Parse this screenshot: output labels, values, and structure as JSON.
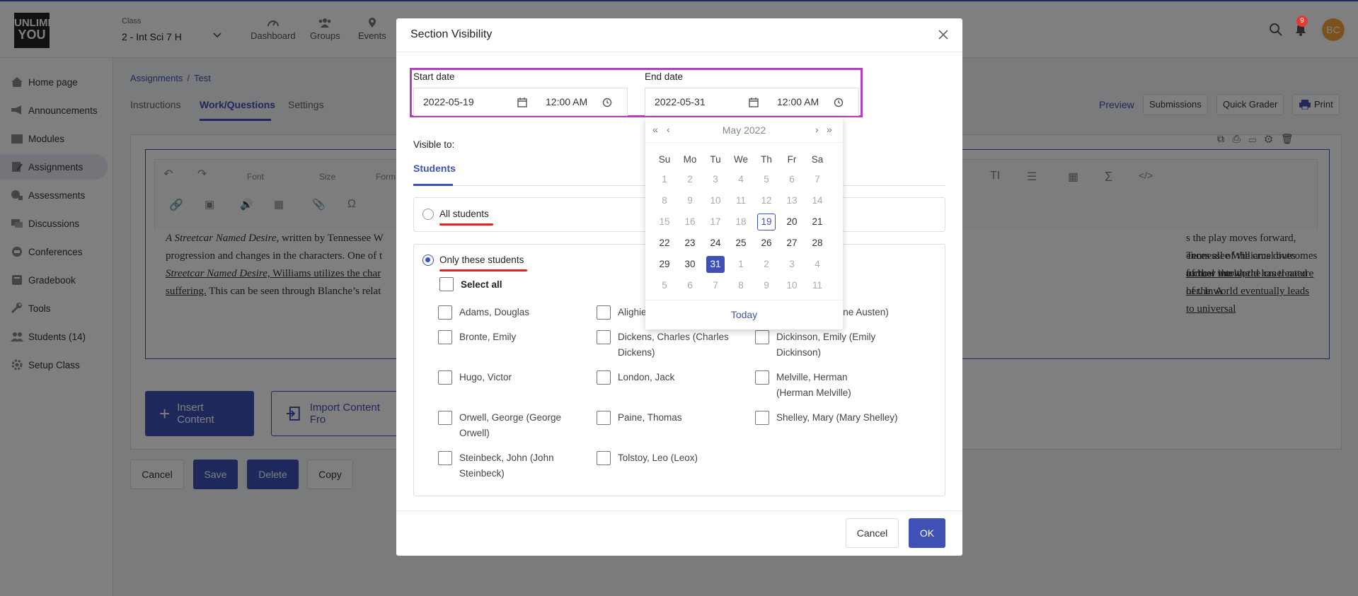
{
  "header": {
    "logo_text": "UNLIMITED YOU",
    "class_label": "Class",
    "class_value": "2 - Int Sci 7 H",
    "nav": [
      {
        "label": "Dashboard",
        "icon": "gauge-icon"
      },
      {
        "label": "Groups",
        "icon": "groups-icon"
      },
      {
        "label": "Events",
        "icon": "location-pin-icon"
      }
    ],
    "notification_count": "9",
    "avatar_initials": "BC"
  },
  "sidebar": {
    "items": [
      {
        "label": "Home page",
        "icon": "home-icon"
      },
      {
        "label": "Announcements",
        "icon": "megaphone-icon"
      },
      {
        "label": "Modules",
        "icon": "modules-icon"
      },
      {
        "label": "Assignments",
        "icon": "assignment-icon",
        "active": true
      },
      {
        "label": "Assessments",
        "icon": "assessment-icon"
      },
      {
        "label": "Discussions",
        "icon": "discussion-icon"
      },
      {
        "label": "Conferences",
        "icon": "conference-icon"
      },
      {
        "label": "Gradebook",
        "icon": "gradebook-icon"
      },
      {
        "label": "Tools",
        "icon": "wrench-icon"
      },
      {
        "label": "Students (14)",
        "icon": "students-icon"
      },
      {
        "label": "Setup Class",
        "icon": "gear-icon"
      }
    ]
  },
  "breadcrumb": {
    "root": "Assignments",
    "sep": "/",
    "current": "Test"
  },
  "page_tabs": [
    "Instructions",
    "Work/Questions",
    "Settings"
  ],
  "right_actions": {
    "preview": "Preview",
    "submissions": "Submissions",
    "quick_grader": "Quick Grader",
    "print": "Print"
  },
  "editor": {
    "font_label": "Font",
    "size_label": "Size",
    "format_label": "Form",
    "text_title": "A Streetcar Named Desire,",
    "text_line1": " written by Tennessee W",
    "text_line2": "progression and changes in the characters. One of t",
    "text_line3a": "Streetcar Named Desire,",
    "text_line3b": " Williams utilizes the char",
    "text_line4a": "suffering.",
    "text_line4b": " This can be seen through Blanche’s relat",
    "text_right1": "s the play moves forward, Tennessee Williams dives further into the",
    "text_right2a": "ences all of the cruel outcomes of how the world has treated her. ",
    "text_right2b": "In A",
    "text_right3": "a cruel world; the cruel nature of the world eventually leads to universal"
  },
  "content_buttons": {
    "insert": "Insert Content",
    "import": "Import Content Fro"
  },
  "footer_buttons": {
    "cancel": "Cancel",
    "save": "Save",
    "delete": "Delete",
    "copy": "Copy"
  },
  "modal": {
    "title": "Section Visibility",
    "start_label": "Start date",
    "start_date": "2022-05-19",
    "start_time": "12:00 AM",
    "end_label": "End date",
    "end_date": "2022-05-31",
    "end_time": "12:00 AM",
    "visible_to": "Visible to:",
    "tab_students": "Students",
    "all_students": "All students",
    "only_these": "Only these students",
    "select_all": "Select all",
    "students": [
      "Adams, Douglas",
      "Alighie",
      "Jane Austen)",
      "Bronte, Emily",
      "Dickens, Charles (Charles Dickens)",
      "Dickinson, Emily (Emily Dickinson)",
      "Hugo, Victor",
      "London, Jack",
      "Melville, Herman (Herman Melville)",
      "Orwell, George (George Orwell)",
      "Paine, Thomas",
      "Shelley, Mary (Mary Shelley)",
      "Steinbeck, John (John Steinbeck)",
      "Tolstoy, Leo (Leox)"
    ],
    "cancel": "Cancel",
    "ok": "OK"
  },
  "calendar": {
    "month": "May 2022",
    "nav_first": "«",
    "nav_prev": "‹",
    "nav_next": "›",
    "nav_last": "»",
    "weekdays": [
      "Su",
      "Mo",
      "Tu",
      "We",
      "Th",
      "Fr",
      "Sa"
    ],
    "weeks": [
      [
        "1",
        "2",
        "3",
        "4",
        "5",
        "6",
        "7"
      ],
      [
        "8",
        "9",
        "10",
        "11",
        "12",
        "13",
        "14"
      ],
      [
        "15",
        "16",
        "17",
        "18",
        "19",
        "20",
        "21"
      ],
      [
        "22",
        "23",
        "24",
        "25",
        "26",
        "27",
        "28"
      ],
      [
        "29",
        "30",
        "31",
        "1",
        "2",
        "3",
        "4"
      ],
      [
        "5",
        "6",
        "7",
        "8",
        "9",
        "10",
        "11"
      ]
    ],
    "today": "Today",
    "accent": "#3f51b5"
  }
}
